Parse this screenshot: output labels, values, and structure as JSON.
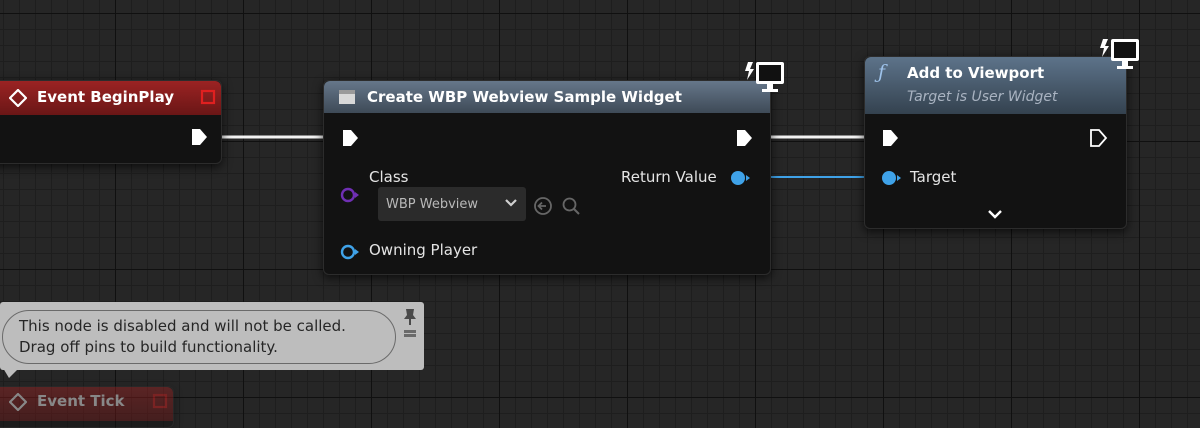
{
  "colors": {
    "event_header": "#8c1f1f",
    "function_header": "#4f6376",
    "create_header": "#4d5a68",
    "object_pin": "#3fa2e8",
    "class_pin": "#6f2fb4",
    "exec_pin": "#ffffff"
  },
  "event_begin_play": {
    "title": "Event BeginPlay",
    "icon": "event-diamond-icon",
    "delegate_icon": "delegate-square-icon"
  },
  "create_widget": {
    "title": "Create WBP Webview Sample Widget",
    "icon": "widget-icon",
    "badge_icon": "server-client-monitor-icon",
    "class_label": "Class",
    "class_value": "WBP Webview",
    "owning_player_label": "Owning Player",
    "return_value_label": "Return Value"
  },
  "add_to_viewport": {
    "title": "Add to Viewport",
    "subtitle": "Target is User Widget",
    "icon": "function-f-icon",
    "badge_icon": "server-client-monitor-icon",
    "target_label": "Target",
    "expand_icon": "chevron-down-icon"
  },
  "disabled_tooltip": {
    "line1": "This node is disabled and will not be called.",
    "line2": "Drag off pins to build functionality.",
    "pin_icon": "pushpin-icon"
  },
  "event_tick": {
    "title": "Event Tick"
  }
}
